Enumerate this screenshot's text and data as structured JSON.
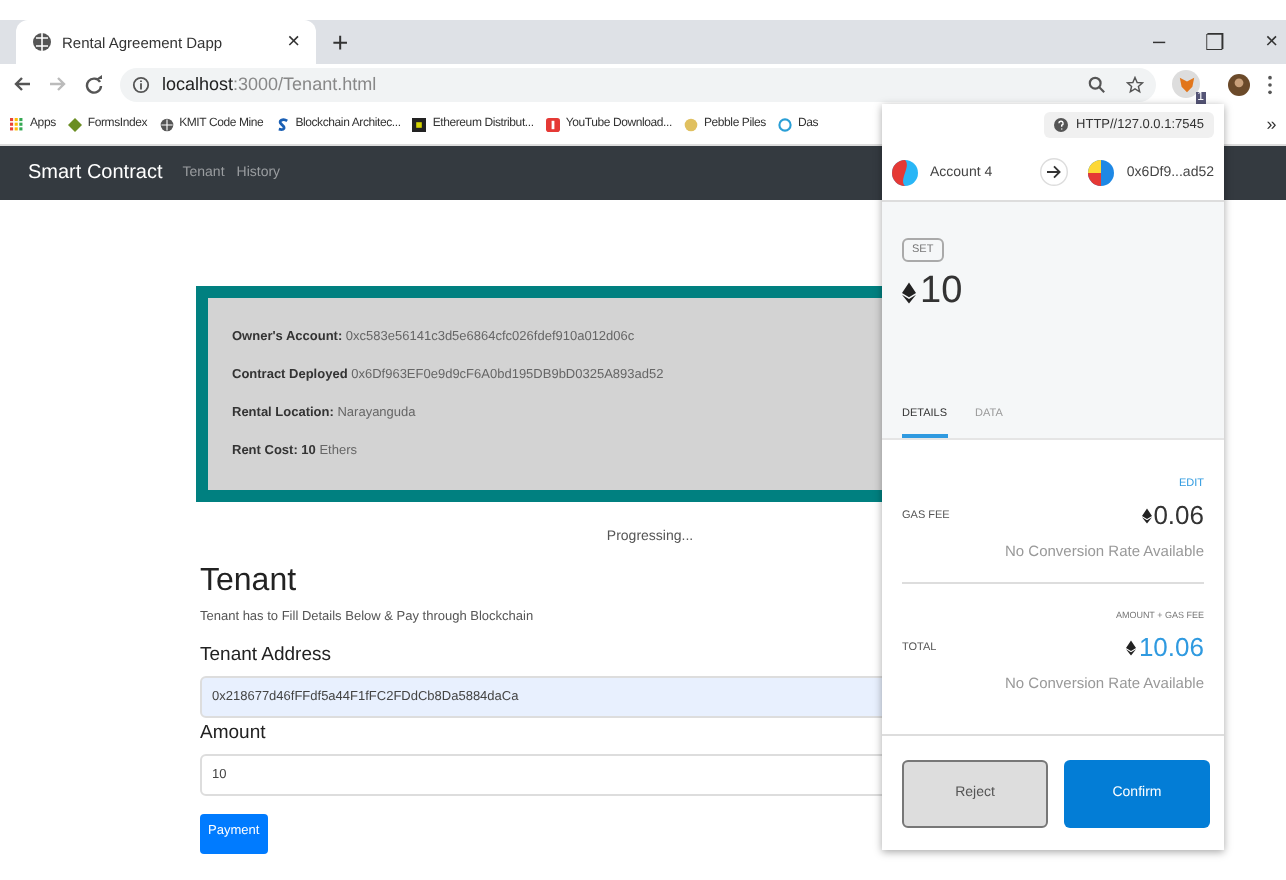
{
  "browser": {
    "tab_title": "Rental Agreement Dapp",
    "tab_close": "×",
    "new_tab": "+",
    "window_controls": [
      "–",
      "❐",
      "×"
    ],
    "url_host": "localhost",
    "url_path": ":3000/Tenant.html",
    "bookmarks": [
      {
        "label": "Apps"
      },
      {
        "label": "FormsIndex"
      },
      {
        "label": "KMIT Code Mine"
      },
      {
        "label": "Blockchain Architec..."
      },
      {
        "label": "Ethereum Distribut..."
      },
      {
        "label": "YouTube Download..."
      },
      {
        "label": "Pebble Piles"
      },
      {
        "label": "Das"
      }
    ],
    "more": "»",
    "badge": "1"
  },
  "navbar": {
    "brand": "Smart Contract",
    "links": [
      {
        "label": "Tenant",
        "selected": false
      },
      {
        "label": "History",
        "selected": false
      }
    ]
  },
  "contract_card": {
    "lines": [
      "**Owner's Account:** 0xc583e56141c3d5e6864cfc026fdef910a012d06c",
      "**Contract Deployed** 0x6Df963EF0e9d9cF6A0bd195DB9bD0325A893ad52",
      "**Rental Location:** Narayanguda",
      "**Rent Cost: 10** Ethers"
    ]
  },
  "status": "Progressing...",
  "tenant": {
    "heading": "Tenant",
    "subtitle": "Tenant has to Fill Details Below & Pay through Blockchain",
    "fields": [
      {
        "label": "Tenant Address",
        "value": "0x218677d46fFFdf5a44F1fFC2FDdCb8Da5884daCa",
        "autofilled": true
      },
      {
        "label": "Amount",
        "value": "10",
        "autofilled": false
      }
    ],
    "submit": "Payment"
  },
  "metamask": {
    "network": "HTTP//127.0.0.1:7545",
    "from": "Account 4",
    "to": "0x6Df9...ad52",
    "method": "SET",
    "amount": "10",
    "tabs": [
      {
        "label": "DETAILS",
        "selected": true
      },
      {
        "label": "DATA",
        "selected": false
      }
    ],
    "edit": "EDIT",
    "gas_label": "GAS FEE",
    "gas_value": "0.06",
    "gas_note": "No Conversion Rate Available",
    "total_caption": "AMOUNT + GAS FEE",
    "total_label": "TOTAL",
    "total_value": "10.06",
    "total_note": "No Conversion Rate Available",
    "buttons": [
      {
        "label": "Reject",
        "kind": "secondary"
      },
      {
        "label": "Confirm",
        "kind": "primary"
      }
    ]
  }
}
